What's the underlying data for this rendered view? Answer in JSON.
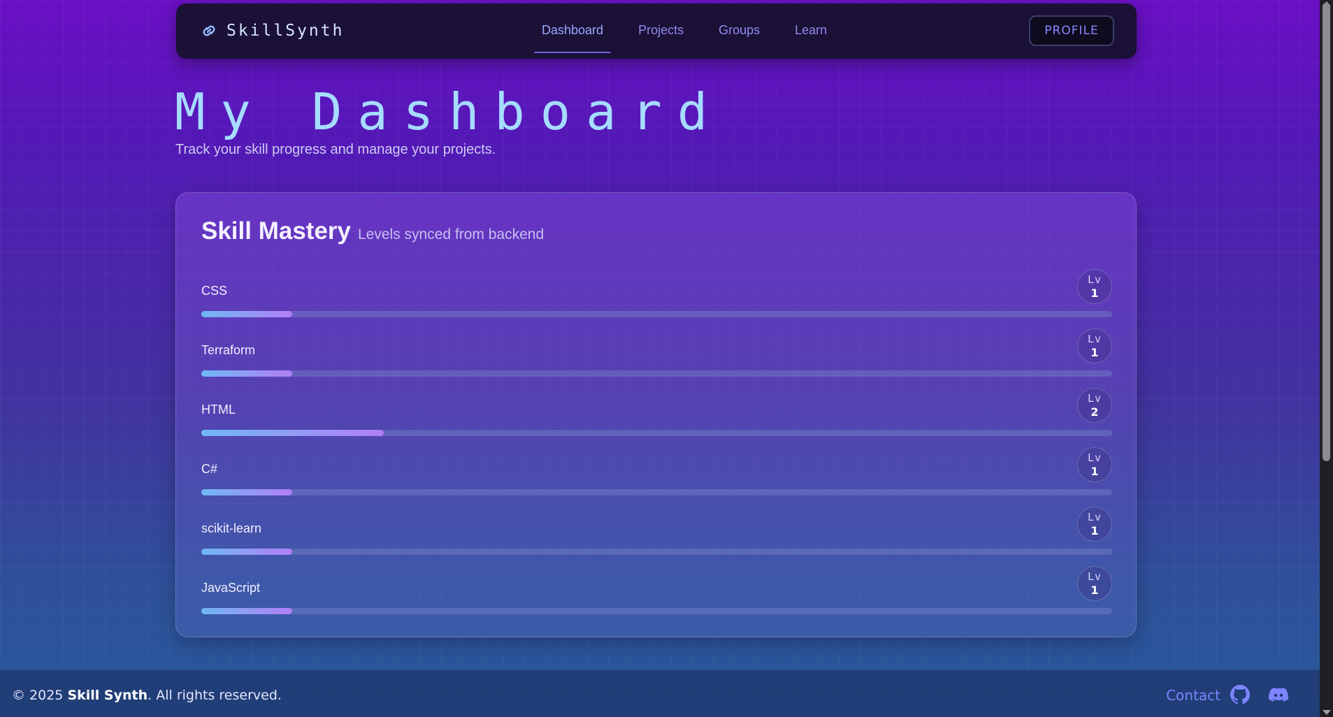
{
  "brand": {
    "name": "SkillSynth",
    "icon": "link-icon"
  },
  "nav": {
    "links": [
      {
        "label": "Dashboard",
        "active": true
      },
      {
        "label": "Projects",
        "active": false
      },
      {
        "label": "Groups",
        "active": false
      },
      {
        "label": "Learn",
        "active": false
      }
    ],
    "profile_label": "PROFILE"
  },
  "header": {
    "title": "My Dashboard",
    "subtitle": "Track your skill progress and manage your projects."
  },
  "skills_card": {
    "title": "Skill Mastery",
    "subtitle": "Levels synced from backend",
    "level_prefix": "Lv",
    "skills": [
      {
        "name": "CSS",
        "level": "1",
        "progress": 0.1
      },
      {
        "name": "Terraform",
        "level": "1",
        "progress": 0.1
      },
      {
        "name": "HTML",
        "level": "2",
        "progress": 0.2
      },
      {
        "name": "C#",
        "level": "1",
        "progress": 0.1
      },
      {
        "name": "scikit-learn",
        "level": "1",
        "progress": 0.1
      },
      {
        "name": "JavaScript",
        "level": "1",
        "progress": 0.1
      }
    ]
  },
  "footer": {
    "copyright_prefix": "© 2025",
    "copyright_brand": "Skill Synth",
    "copyright_suffix": ". All rights reserved.",
    "contact_label": "Contact",
    "icons": [
      "github-icon",
      "discord-icon"
    ]
  },
  "colors": {
    "accent": "#8a86ff",
    "title": "#a6dcff",
    "bar_start": "#6fb8f4",
    "bar_end": "#b27ef5"
  }
}
